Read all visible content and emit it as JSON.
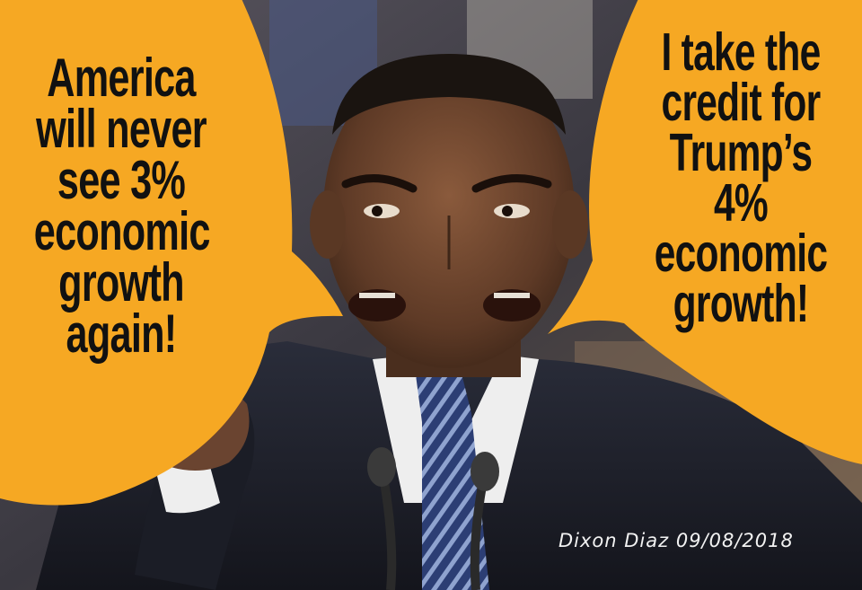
{
  "meme": {
    "left_bubble": {
      "lines": [
        "America",
        "will never",
        "see 3%",
        "economic",
        "growth",
        "again!"
      ]
    },
    "right_bubble": {
      "lines": [
        "I take the",
        "credit for",
        "Trump’s",
        "4%",
        "economic",
        "growth!"
      ]
    },
    "signature": "Dixon Diaz 09/08/2018",
    "colors": {
      "bubble": "#F6A823",
      "text": "#111111",
      "suit": "#1b1d26",
      "shirt": "#eeeeee",
      "tie": "#3a4f8a"
    }
  }
}
